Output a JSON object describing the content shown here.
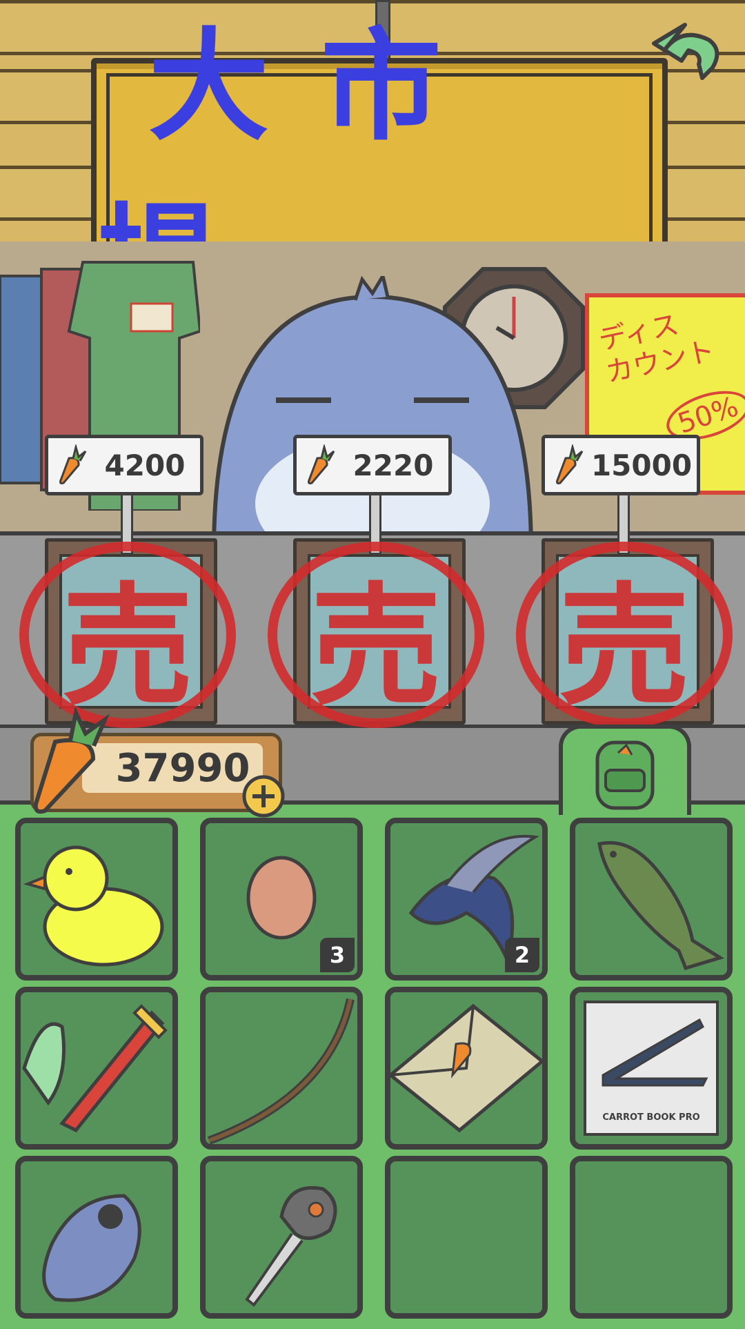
{
  "screen": {
    "sign_title": "大市場",
    "back_icon": "back-arrow-icon",
    "poster": {
      "line1": "ディス",
      "line2": "カウント",
      "sale": "50%"
    }
  },
  "market": {
    "currency_icon": "carrot-icon",
    "sold_label": "売",
    "items": [
      {
        "price": "4200",
        "status": "sold"
      },
      {
        "price": "2220",
        "status": "sold"
      },
      {
        "price": "15000",
        "status": "sold"
      }
    ]
  },
  "wallet": {
    "carrots": "37990",
    "add_icon": "plus-icon"
  },
  "inventory": {
    "tab_icon": "backpack-icon",
    "items": [
      {
        "name": "rubber-duck",
        "count": ""
      },
      {
        "name": "egg",
        "count": "3"
      },
      {
        "name": "flying-fish",
        "count": "2"
      },
      {
        "name": "bass-fish",
        "count": ""
      },
      {
        "name": "brush",
        "count": ""
      },
      {
        "name": "bow",
        "count": ""
      },
      {
        "name": "carrot-envelope",
        "count": ""
      },
      {
        "name": "carrot-book-pro",
        "count": "",
        "label": "CARROT BOOK PRO"
      },
      {
        "name": "remote",
        "count": ""
      },
      {
        "name": "key",
        "count": ""
      },
      {
        "name": "empty",
        "count": ""
      },
      {
        "name": "empty",
        "count": ""
      }
    ]
  },
  "colors": {
    "sign": "#e2b83f",
    "sign_text": "#3b3fe0",
    "inventory_bg": "#6fbf6a",
    "cell_bg": "#55935a",
    "sold_red": "#d22b2b"
  }
}
